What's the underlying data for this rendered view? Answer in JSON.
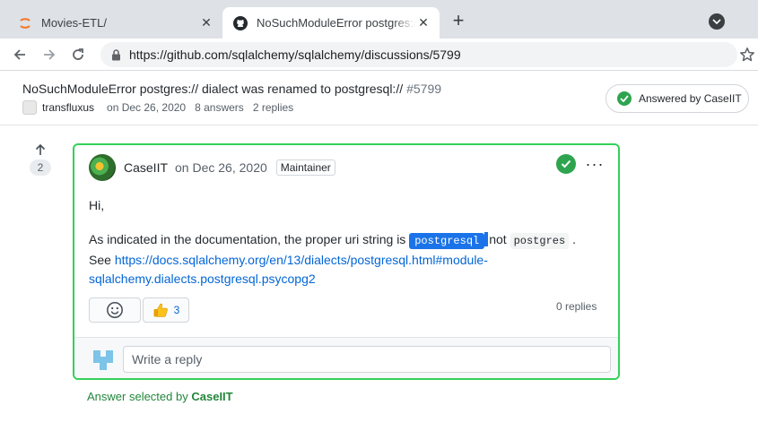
{
  "browser": {
    "tabs": [
      {
        "title": "Movies-ETL/",
        "active": false,
        "favicon": "jupyter-icon"
      },
      {
        "title": "NoSuchModuleError postgres:// d",
        "active": true,
        "favicon": "github-icon"
      }
    ],
    "url": "https://github.com/sqlalchemy/sqlalchemy/discussions/5799"
  },
  "discussion": {
    "title": "NoSuchModuleError postgres:// dialect was renamed to postgresql://",
    "number": "#5799",
    "author": "transfluxus",
    "date": "on Dec 26, 2020",
    "answers": "8 answers",
    "replies": "2 replies",
    "answered_label": "Answered by CaseIIT"
  },
  "answer": {
    "votes": "2",
    "author": "CaseIIT",
    "date": "on Dec 26, 2020",
    "badge": "Maintainer",
    "greeting": "Hi,",
    "text_before": "As indicated in the documentation, the proper uri string is",
    "code_selected": "postgresql",
    "text_middle": "not",
    "code_other": "postgres",
    "text_after": ".",
    "see_prefix": "See",
    "link": "https://docs.sqlalchemy.org/en/13/dialects/postgresql.html#module-sqlalchemy.dialects.postgresql.psycopg2",
    "thumbs_count": "3",
    "replies": "0 replies",
    "reply_placeholder": "Write a reply"
  },
  "selected_by": {
    "prefix": "Answer selected by",
    "name": "CaseIIT"
  },
  "colors": {
    "accent_green": "#2ea44f",
    "border_green": "#34d058",
    "link_blue": "#0366d6",
    "selection_blue": "#1a73e8"
  }
}
